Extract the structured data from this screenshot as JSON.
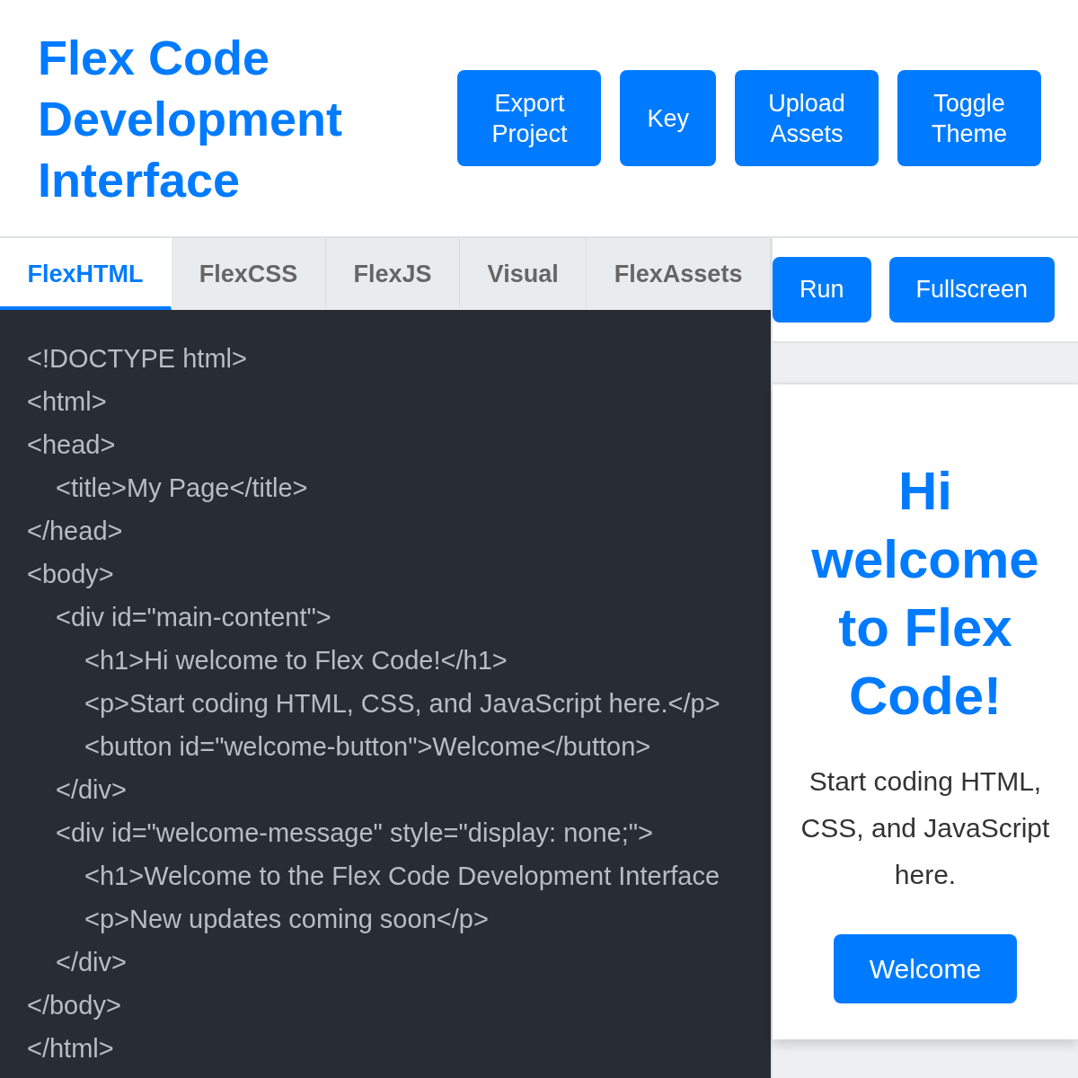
{
  "header": {
    "title": "Flex Code Development Interface",
    "buttons": [
      "Export Project",
      "Key",
      "Upload Assets",
      "Toggle Theme"
    ]
  },
  "editor": {
    "tabs": [
      {
        "label": "FlexHTML",
        "selected": true
      },
      {
        "label": "FlexCSS",
        "selected": false
      },
      {
        "label": "FlexJS",
        "selected": false
      },
      {
        "label": "Visual",
        "selected": false
      },
      {
        "label": "FlexAssets",
        "selected": false
      }
    ],
    "code": [
      {
        "text": "<!DOCTYPE html>"
      },
      {
        "text": "<html>"
      },
      {
        "text": "<head>",
        "children": [
          {
            "text": "<title>My Page</title>"
          }
        ]
      },
      {
        "text": "</head>"
      },
      {
        "text": "<body>",
        "children": [
          {
            "text": "<div id=\"main-content\">",
            "children": [
              {
                "text": "<h1>Hi welcome to Flex Code!</h1>"
              },
              {
                "text": "<p>Start coding HTML, CSS, and JavaScript here.</p>"
              },
              {
                "text": "<button id=\"welcome-button\">Welcome</button>"
              }
            ]
          },
          {
            "text": "</div>"
          },
          {
            "text": "<div id=\"welcome-message\" style=\"display: none;\">",
            "children": [
              {
                "text": "<h1>Welcome to the Flex Code Development Interface"
              },
              {
                "text": "<p>New updates coming soon</p>"
              }
            ]
          },
          {
            "text": "</div>"
          }
        ]
      },
      {
        "text": "</body>"
      },
      {
        "text": "</html>"
      }
    ]
  },
  "preview_toolbar": {
    "buttons": [
      "Run",
      "Fullscreen"
    ]
  },
  "preview": {
    "heading": "Hi welcome to Flex Code!",
    "text": "Start coding HTML, CSS, and JavaScript here.",
    "button": "Welcome"
  }
}
